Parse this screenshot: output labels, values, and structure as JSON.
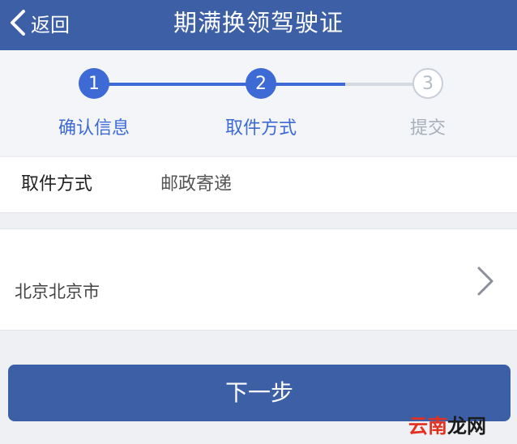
{
  "header": {
    "back_label": "返回",
    "title": "期满换领驾驶证"
  },
  "steps": [
    {
      "number": "1",
      "label": "确认信息",
      "state": "active"
    },
    {
      "number": "2",
      "label": "取件方式",
      "state": "active"
    },
    {
      "number": "3",
      "label": "提交",
      "state": "pending"
    }
  ],
  "pickup": {
    "label": "取件方式",
    "value": "邮政寄递"
  },
  "address": {
    "value": "北京北京市"
  },
  "next_button": "下一步",
  "watermark": {
    "part1": "云南",
    "part2": "龙网"
  },
  "colors": {
    "header_bg": "#3c5fa6",
    "accent": "#3e6ad6",
    "pending": "#b5bcc7"
  }
}
